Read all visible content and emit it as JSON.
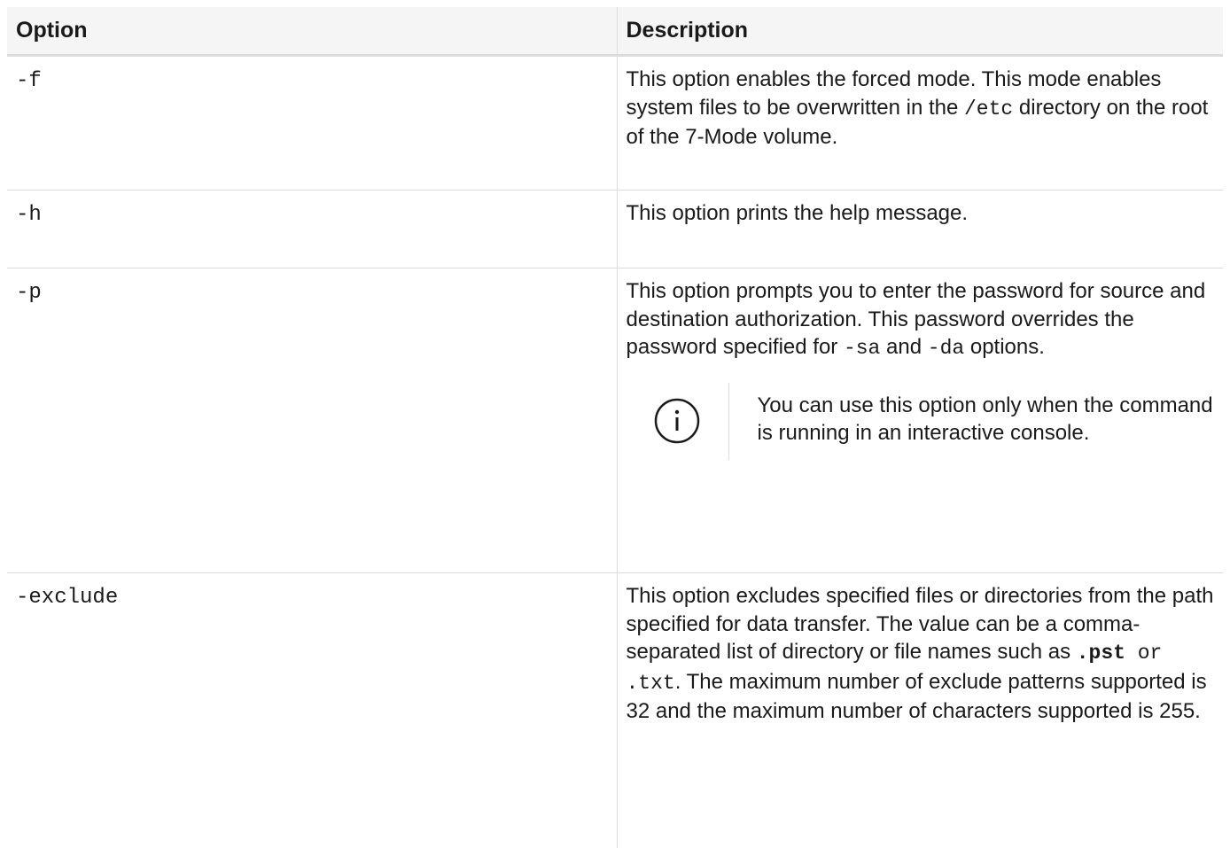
{
  "table": {
    "headers": {
      "option": "Option",
      "description": "Description"
    },
    "rows": [
      {
        "option": "-f",
        "description": {
          "t1": "This option enables the forced mode. This mode enables system files to be overwritten in the ",
          "c1": "/etc",
          "t2": " directory on the root of the 7-Mode volume."
        }
      },
      {
        "option": "-h",
        "description": {
          "t1": "This option prints the help message."
        }
      },
      {
        "option": "-p",
        "description": {
          "t1": "This option prompts you to enter the password for source and destination authorization. This password overrides the password specified for ",
          "c1": "-sa",
          "t2": " and ",
          "c2": "-da",
          "t3": " options."
        },
        "note": {
          "icon": "info-circle-icon",
          "text": "You can use this option only when the command is running in an interactive console."
        }
      },
      {
        "option": "-exclude",
        "description": {
          "t1": "This option excludes specified files or directories from the path specified for data transfer. The value can be a comma-separated list of directory or file names such as ",
          "b1": ".pst",
          "c1": " or ",
          "c2": ".txt",
          "t2": ". The maximum number of exclude patterns supported is 32 and the maximum number of characters supported is 255."
        }
      }
    ]
  },
  "colors": {
    "header_bg": "#f5f5f5",
    "border": "#dcdcdc",
    "icon": "#1a1a1a"
  }
}
